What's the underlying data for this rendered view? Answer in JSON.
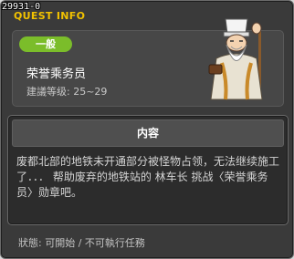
{
  "quest_id": "29931-0",
  "window_title": "QUEST INFO",
  "quest": {
    "category": "一般",
    "name": "荣誉乘务员",
    "level_requirement": "建議等级: 25~29"
  },
  "npc": {
    "icon": "old-sage-npc-icon"
  },
  "content": {
    "header": "内容",
    "body": "废都北部的地铁未开通部分被怪物占领，无法继续施工了．．． 帮助废弃的地铁站的 林车长 挑战〈荣誉乘务员〉勋章吧。"
  },
  "status": "狀態: 可開始 / 不可執行任務",
  "colors": {
    "title": "#f2c200",
    "badge": "#7bbd2a",
    "window_bg": "#3a3a3a"
  }
}
